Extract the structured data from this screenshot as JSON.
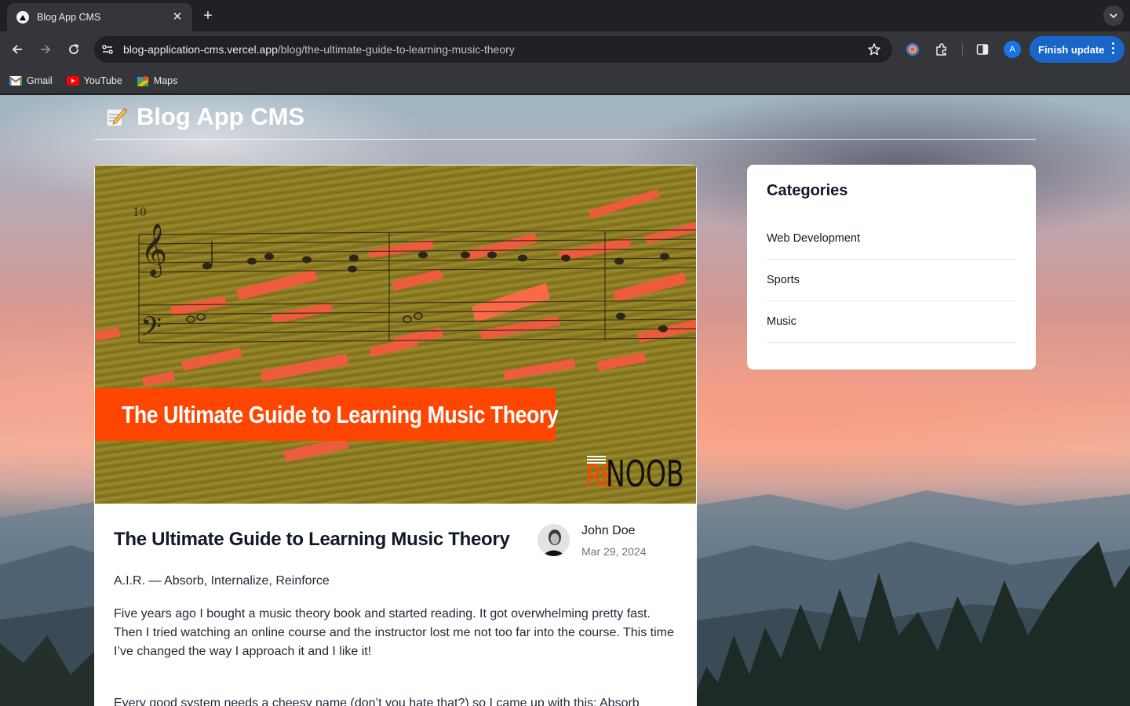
{
  "browser": {
    "tab": {
      "title": "Blog App CMS",
      "close_glyph": "✕"
    },
    "new_tab_glyph": "+",
    "url": {
      "host": "blog-application-cms.vercel.app",
      "path": "/blog/the-ultimate-guide-to-learning-music-theory"
    },
    "profile_initial": "A",
    "finish_update_label": "Finish update",
    "bookmarks": [
      {
        "label": "Gmail",
        "icon": "gmail-icon"
      },
      {
        "label": "YouTube",
        "icon": "youtube-icon"
      },
      {
        "label": "Maps",
        "icon": "maps-icon"
      }
    ]
  },
  "site": {
    "title": "Blog App CMS",
    "logo_icon": "memo-icon"
  },
  "post": {
    "image": {
      "banner_text": "The Ultimate Guide to Learning Music Theory",
      "logo_re": "RE",
      "logo_noob": "NOOB",
      "measure_number": "10"
    },
    "title": "The Ultimate Guide to Learning Music Theory",
    "author": "John Doe",
    "date": "Mar 29, 2024",
    "subtitle": "A.I.R. — Absorb, Internalize, Reinforce",
    "paragraph": "Five years ago I bought a music theory book and started reading. It got overwhelming pretty fast. Then I tried watching an online course and the instructor lost me not too far into the course. This time I’ve changed the way I approach it and I like it!",
    "paragraph_2": "Every good system needs a cheesy name (don’t you hate that?) so I came up with this: Absorb"
  },
  "categories": {
    "heading": "Categories",
    "items": [
      {
        "label": "Web Development"
      },
      {
        "label": "Sports"
      },
      {
        "label": "Music"
      }
    ]
  },
  "colors": {
    "chrome_dark": "#202124",
    "chrome_toolbar": "#35363a",
    "finish_update": "#1a66c8",
    "banner_orange": "#fe4600"
  }
}
